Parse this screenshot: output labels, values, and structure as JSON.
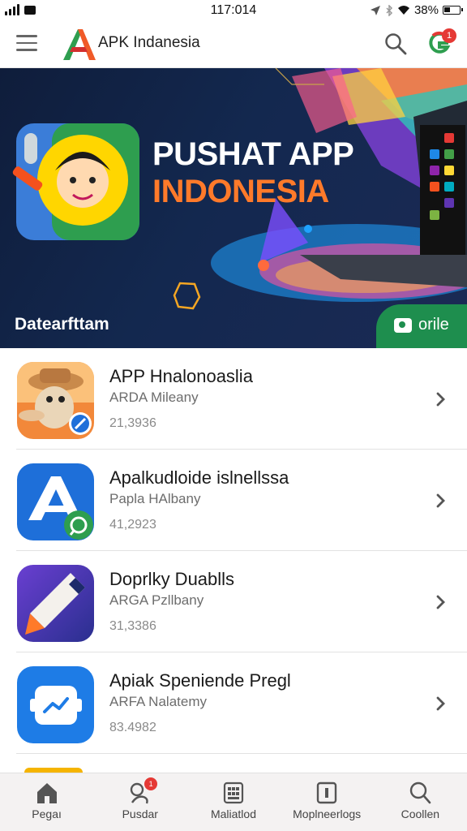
{
  "status_bar": {
    "time": "117:014",
    "battery": "38%",
    "icons": [
      "signal-icon",
      "sim-icon",
      "location-icon",
      "bluetooth-icon",
      "wifi-icon",
      "battery-icon"
    ]
  },
  "app_bar": {
    "title": "APK Indanesia",
    "icons": [
      "menu-icon",
      "logo-icon",
      "search-icon",
      "account-avatar"
    ],
    "notification_count": "1"
  },
  "banner": {
    "title_line1": "PUSHAT APP",
    "title_line2": "INDONESIA",
    "caption": "Datearfttam",
    "cta_label": "orile",
    "colors": {
      "title_accent": "#ff7a2a",
      "cta": "#1e8e4e",
      "background": "#13284f"
    }
  },
  "apps": [
    {
      "name": "APP Hnalonoaslia",
      "developer": "ARDA Mileany",
      "count": "21,3936",
      "icon": "cartoon-character-icon"
    },
    {
      "name": "Apalkudloide islnellssa",
      "developer": "Papla HAlbany",
      "count": "41,2923",
      "icon": "letter-a-icon"
    },
    {
      "name": "Doprlky Duablls",
      "developer": "ARGA Pzllbany",
      "count": "31,3386",
      "icon": "pen-icon"
    },
    {
      "name": "Apiak Speniende Pregl",
      "developer": "ARFA Nalatemy",
      "count": "83.4982",
      "icon": "chart-card-icon"
    }
  ],
  "bottom_nav": [
    {
      "label": "Pegaı",
      "icon": "home-icon"
    },
    {
      "label": "Pusdar",
      "icon": "categories-icon",
      "badge": "1"
    },
    {
      "label": "Maliatlod",
      "icon": "grid-icon"
    },
    {
      "label": "Moplneerlogs",
      "icon": "bookmark-icon"
    },
    {
      "label": "Coollen",
      "icon": "search-icon"
    }
  ]
}
